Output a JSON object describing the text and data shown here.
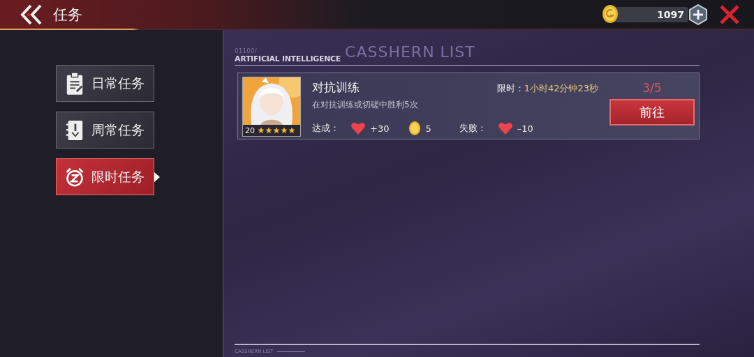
{
  "header": {
    "title": "任务",
    "coins": "1097"
  },
  "section": {
    "code": "01100/",
    "title": "ARTIFICIAL INTELLIGENCE",
    "watermark": "CASSHERN LIST"
  },
  "tabs": [
    {
      "label": "日常任务",
      "selected": false,
      "kind": "clipboard"
    },
    {
      "label": "周常任务",
      "selected": false,
      "kind": "notebook"
    },
    {
      "label": "限时任务",
      "selected": true,
      "kind": "alarm"
    }
  ],
  "tasks": [
    {
      "name": "对抗训练",
      "time_label": "限时：",
      "time_value": "1小时42分钟23秒",
      "description": "在对抗训练或切磋中胜利5次",
      "level": "20",
      "stars": 5,
      "progress": "3/5",
      "reward_label": "达成：",
      "rewards": [
        {
          "kind": "heart",
          "amount": "+30"
        },
        {
          "kind": "coin",
          "amount": "5"
        }
      ],
      "penalty_label": "失败：",
      "penalty": {
        "kind": "heart",
        "amount": "–10"
      },
      "button": "前往"
    }
  ],
  "footer": "CASSHERN LIST"
}
